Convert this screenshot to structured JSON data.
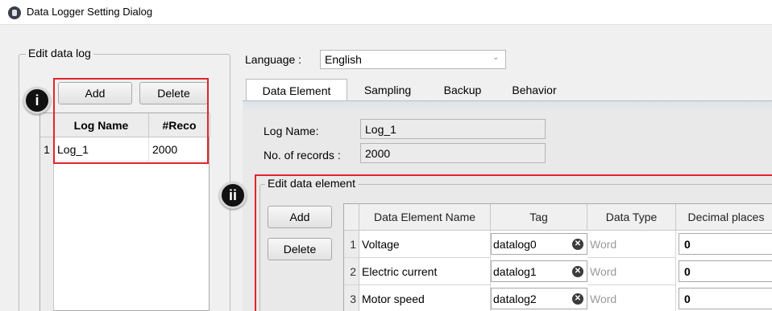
{
  "window": {
    "title": "Data Logger Setting Dialog",
    "icon": "app-logo-icon"
  },
  "left_panel": {
    "group_label": "Edit data log",
    "marker": "i",
    "add_label": "Add",
    "delete_label": "Delete",
    "columns": [
      "Log Name",
      "#Reco"
    ],
    "rows": [
      {
        "num": "1",
        "name": "Log_1",
        "records": "2000"
      }
    ]
  },
  "language": {
    "label": "Language :",
    "value": "English"
  },
  "tabs": [
    "Data Element",
    "Sampling",
    "Backup",
    "Behavior"
  ],
  "active_tab": "Data Element",
  "data_element": {
    "log_name_label": "Log Name:",
    "log_name_value": "Log_1",
    "records_label": "No. of records :",
    "records_value": "2000",
    "group_label": "Edit data element",
    "marker": "ii",
    "add_label": "Add",
    "delete_label": "Delete",
    "columns": [
      "Data Element Name",
      "Tag",
      "Data Type",
      "Decimal places"
    ],
    "rows": [
      {
        "num": "1",
        "name": "Voltage",
        "tag": "datalog0",
        "type": "Word",
        "decimals": "0"
      },
      {
        "num": "2",
        "name": "Electric current",
        "tag": "datalog1",
        "type": "Word",
        "decimals": "0"
      },
      {
        "num": "3",
        "name": "Motor speed",
        "tag": "datalog2",
        "type": "Word",
        "decimals": "0"
      }
    ]
  },
  "colors": {
    "highlight": "#e3242b",
    "marker_bg": "#111111"
  }
}
